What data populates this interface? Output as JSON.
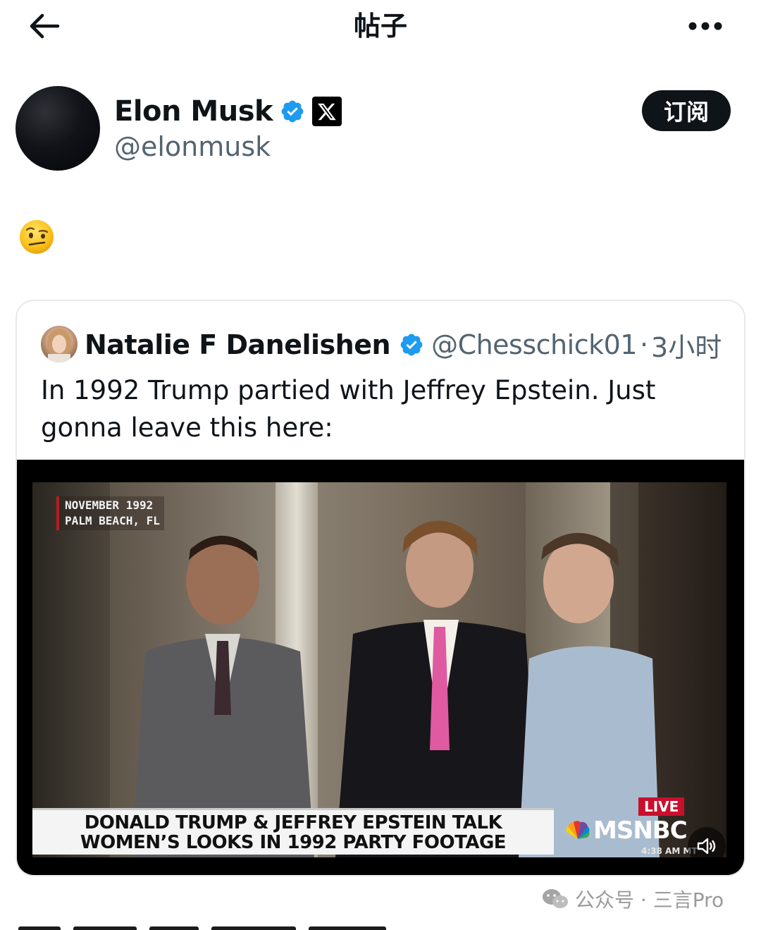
{
  "topbar": {
    "title": "帖子",
    "back_icon": "arrow-left-icon",
    "more_icon": "more-horizontal-icon"
  },
  "author": {
    "name": "Elon Musk",
    "handle": "@elonmusk",
    "verified_icon": "verified-badge-icon",
    "affiliate_icon": "x-logo-icon",
    "subscribe_label": "订阅"
  },
  "post": {
    "emoji": "raised-eyebrow-face-emoji"
  },
  "quote": {
    "name": "Natalie F Danelishen",
    "handle": "@Chesschick01",
    "separator": "·",
    "time": "3小时",
    "text": "In 1992 Trump partied with Jeffrey Epstein. Just gonna leave this here:",
    "video": {
      "date_tag_line1": "NOVEMBER 1992",
      "date_tag_line2": "PALM BEACH, FL",
      "headline_line1": "DONALD TRUMP & JEFFREY EPSTEIN TALK",
      "headline_line2": "WOMEN’S LOOKS IN 1992 PARTY FOOTAGE",
      "live_label": "LIVE",
      "network": "MSNBC",
      "clock": "4:38 AM MT",
      "volume_icon": "volume-icon"
    }
  },
  "watermark": {
    "text": "公众号 · 三言Pro",
    "icon": "wechat-icon"
  },
  "colors": {
    "text_primary": "#0f1419",
    "text_secondary": "#536471",
    "verified_blue": "#1d9bf0",
    "border": "#e7e9ea",
    "live_red": "#c8102e"
  }
}
